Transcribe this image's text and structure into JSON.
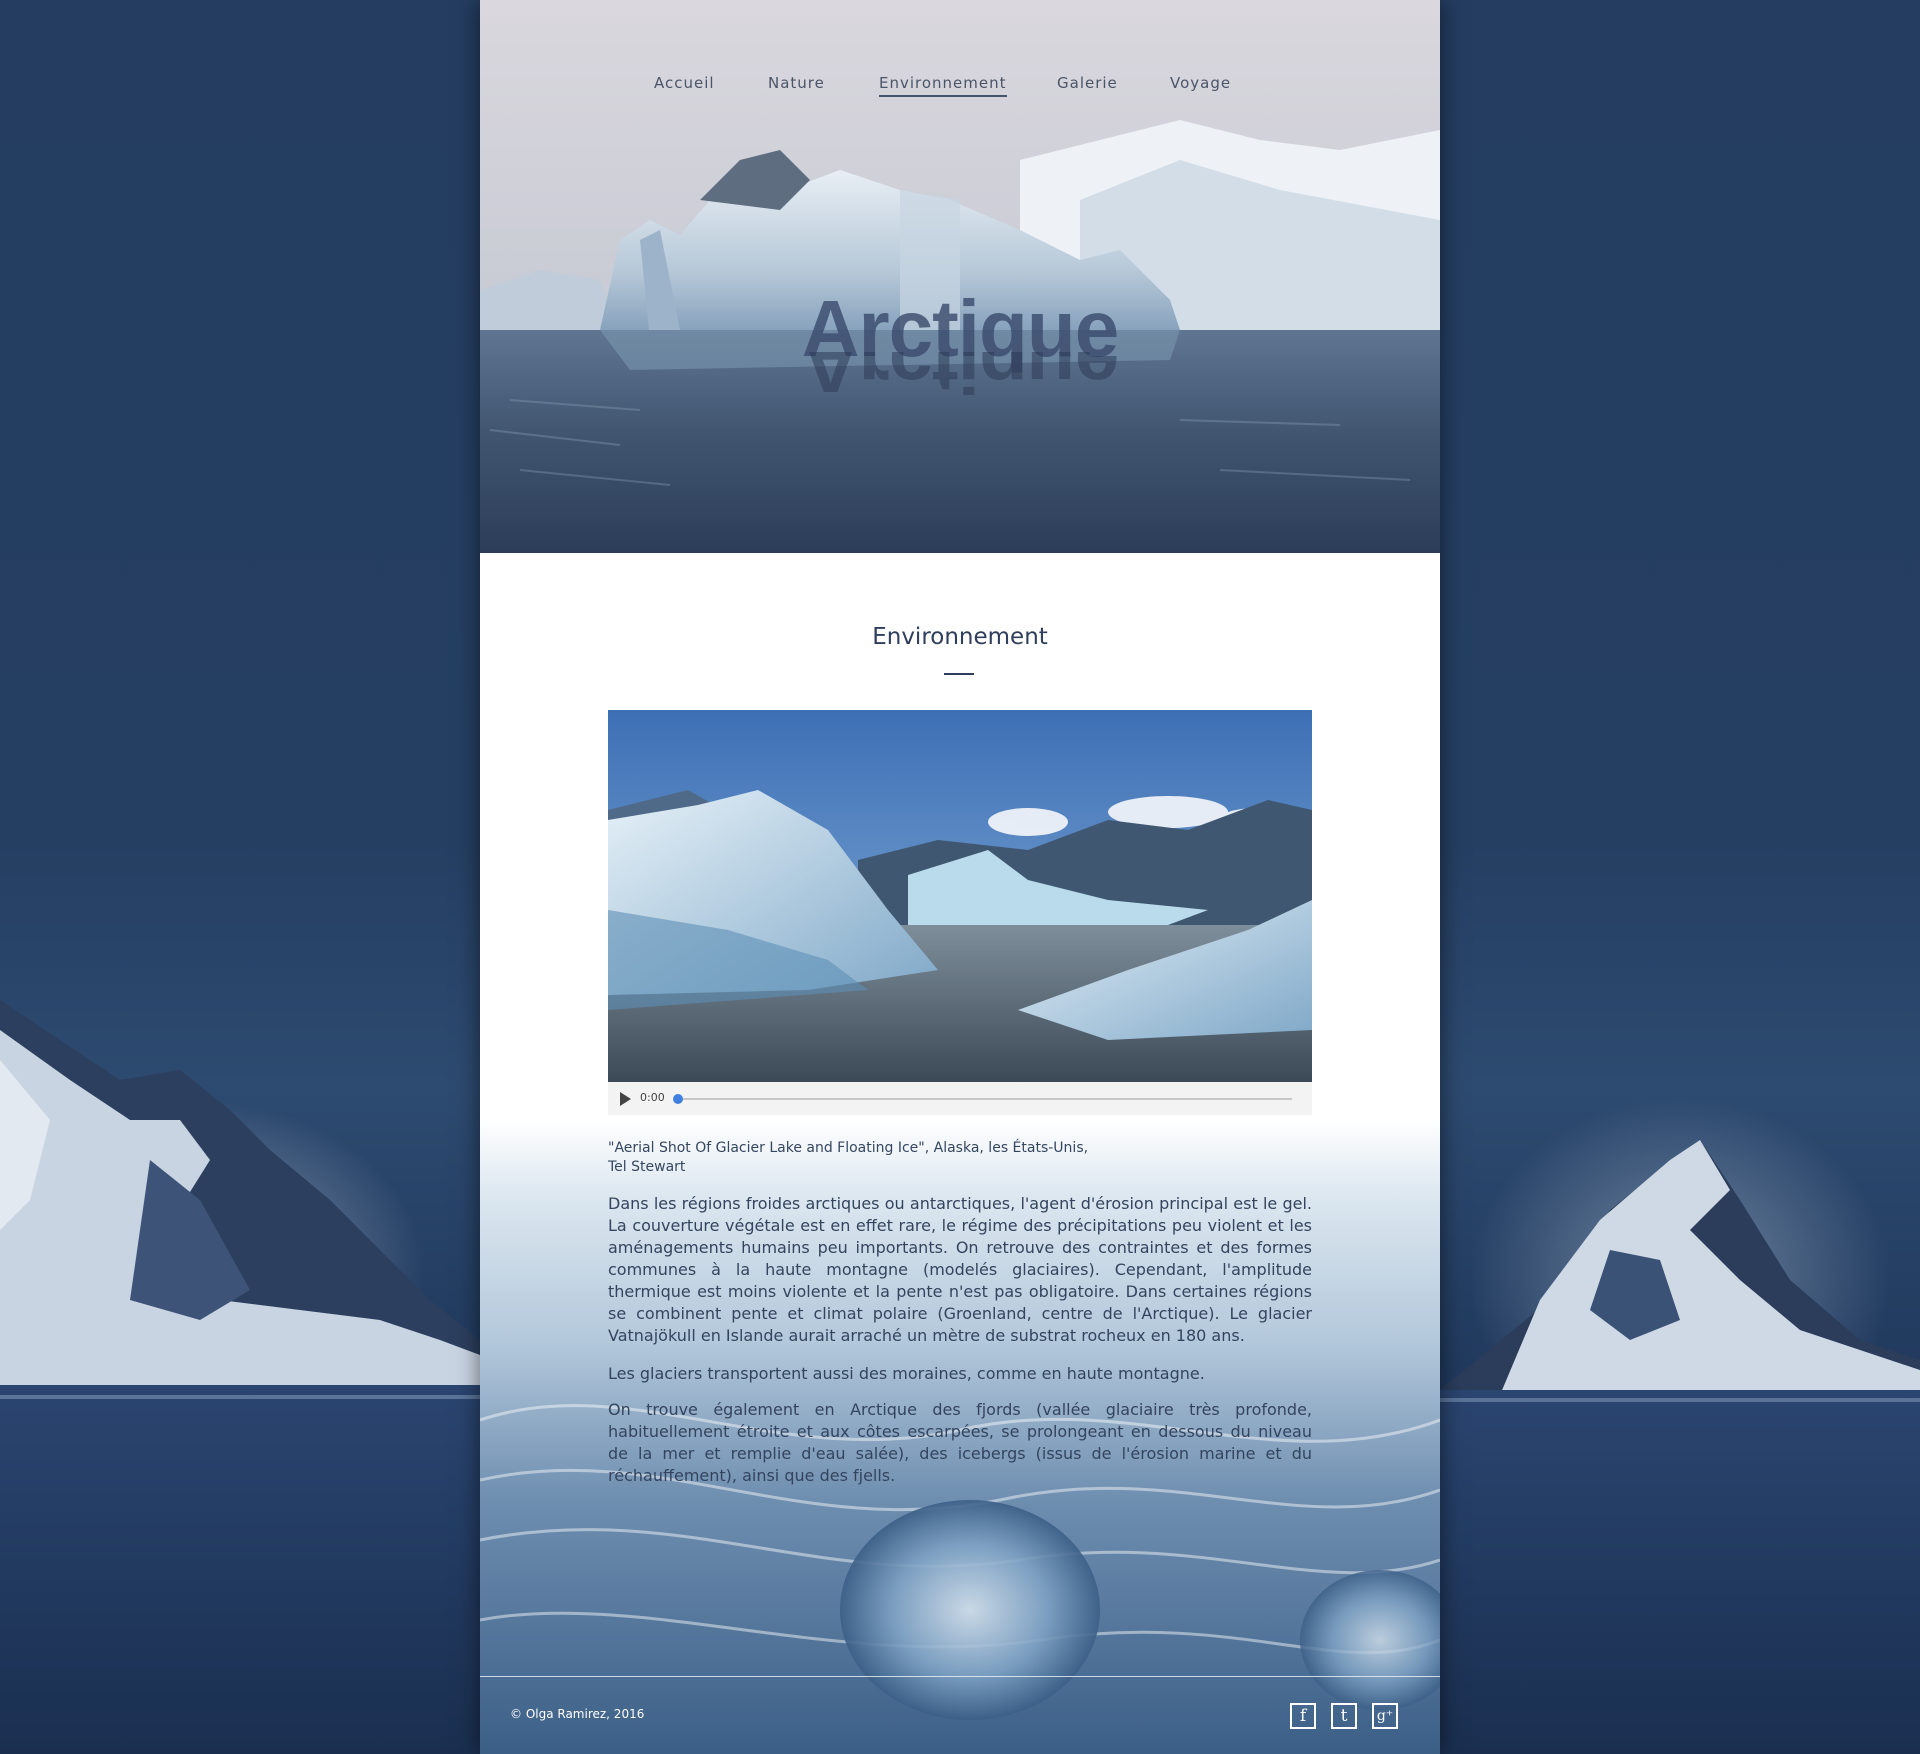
{
  "nav": {
    "items": [
      {
        "label": "Accueil"
      },
      {
        "label": "Nature"
      },
      {
        "label": "Environnement"
      },
      {
        "label": "Galerie"
      },
      {
        "label": "Voyage"
      }
    ],
    "active": "Environnement"
  },
  "hero": {
    "title": "Arctique"
  },
  "main": {
    "heading": "Environnement",
    "video": {
      "time": "0:00",
      "progress": 0
    },
    "caption_line1": "\"Aerial Shot Of Glacier Lake and Floating Ice\", Alaska, les États-Unis,",
    "caption_line2": "Tel Stewart",
    "paragraphs": [
      "Dans les régions froides arctiques ou antarctiques, l'agent d'érosion principal est le gel. La couverture végétale est en effet rare, le régime des précipitations peu violent et les aménagements humains peu importants. On retrouve des contraintes et des formes communes à la haute montagne (modelés glaciaires). Cependant, l'amplitude thermique est moins violente et la pente n'est pas obligatoire. Dans certaines régions se combinent pente et climat polaire (Groenland, centre de l'Arctique). Le glacier Vatnajökull en Islande aurait arraché un mètre de substrat rocheux en 180 ans.",
      "Les glaciers transportent aussi des moraines, comme en haute montagne.",
      "On trouve également en Arctique des fjords (vallée glaciaire très profonde, habituellement étroite et aux côtes escarpées, se prolongeant en dessous du niveau de la mer et remplie d'eau salée), des icebergs (issus de l'érosion marine et du réchauffement), ainsi que des fjells."
    ]
  },
  "footer": {
    "copyright": "© Olga Ramirez, 2016",
    "social": [
      {
        "glyph": "f",
        "icon": "facebook-icon"
      },
      {
        "glyph": "t",
        "icon": "twitter-icon"
      },
      {
        "glyph": "g⁺",
        "icon": "google-plus-icon"
      }
    ]
  },
  "colors": {
    "background": "#243d61",
    "text": "#34445e",
    "heading": "#2f3e5c",
    "progress_knob": "#3f80e0"
  }
}
